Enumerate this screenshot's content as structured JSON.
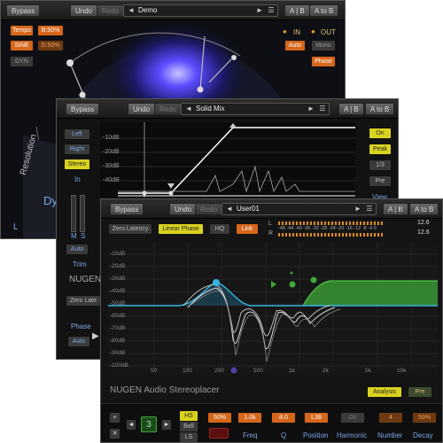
{
  "window1": {
    "bypass": "Bypass",
    "undo": "Undo",
    "redo": "Redo",
    "preset": "Demo",
    "ab": "A | B",
    "atob": "A to B",
    "tempo": "Tempo",
    "tempo_val": "B:50%",
    "sine": "SINE",
    "sine_val": "D:50%",
    "dyn": "DYN",
    "in_label": "IN",
    "out_label": "OUT",
    "auto": "Auto",
    "mono": "Mono",
    "phase": "Phase",
    "resolution": "Resolution",
    "dy": "Dy",
    "l": "L"
  },
  "window2": {
    "bypass": "Bypass",
    "undo": "Undo",
    "redo": "Redo",
    "preset": "Solid Mix",
    "ab": "A | B",
    "atob": "A to B",
    "left": "Left",
    "right": "Right",
    "stereo": "Stereo",
    "in": "In",
    "m": "M",
    "s": "S",
    "auto": "Auto",
    "trim": "Trim",
    "nugen": "NUGEN",
    "zero_late": "Zero Late",
    "phase": "Phase",
    "auto2": "Auto",
    "db_labels": [
      "-10dB",
      "-20dB",
      "-30dB",
      "-40dB",
      "-50dB"
    ],
    "on": "On",
    "peak": "Peak",
    "third": "1/3",
    "pre": "Pre",
    "view": "View"
  },
  "window3": {
    "bypass": "Bypass",
    "undo": "Undo",
    "redo": "Redo",
    "preset": "User01",
    "ab": "A | B",
    "atob": "A to B",
    "zero_latency": "Zero Latency",
    "linear_phase": "Linear Phase",
    "hq": "HQ",
    "link": "Link",
    "meter_scale": "-48 -44 -40 -36 -32 -28 -24 -20 -16 -12 -8  -4  0",
    "meter_l": "L",
    "meter_r": "R",
    "peak_l": "12.6",
    "peak_r": "12.6",
    "db_labels": [
      "-10dB",
      "-20dB",
      "-30dB",
      "-40dB",
      "-50dB",
      "-60dB",
      "-70dB",
      "-80dB",
      "-90dB",
      "-100dB"
    ],
    "freq_labels": [
      "50",
      "100",
      "200",
      "500",
      "1k",
      "2k",
      "5k",
      "10k"
    ],
    "brand": "NUGEN Audio Stereoplacer",
    "analysis": "Analysis",
    "pre": "Pre",
    "plus": "+",
    "cross": "✕",
    "prev": "◄",
    "band": "3",
    "next": "►",
    "hs": "HS",
    "bell": "Bell",
    "ls": "LS",
    "params": [
      {
        "value": "50%",
        "label": ""
      },
      {
        "value": "1.0k",
        "label": "Freq"
      },
      {
        "value": "8.0",
        "label": "Q"
      },
      {
        "value": "L38",
        "label": "Position"
      },
      {
        "value": "On",
        "label": "Harmonic"
      },
      {
        "value": "4",
        "label": "Number"
      },
      {
        "value": "59%",
        "label": "Decay"
      }
    ]
  },
  "colors": {
    "accent": "#d6661a",
    "active_yellow": "#d9d31f",
    "eq_green": "#3fa83a",
    "band_blue": "#3ab4e0"
  }
}
